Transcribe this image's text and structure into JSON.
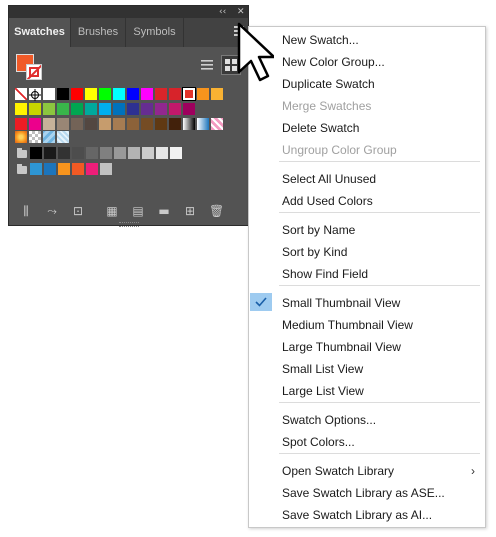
{
  "panel": {
    "titlebar": {
      "collapse_glyph": "‹‹",
      "close_glyph": "✕"
    },
    "tabs": [
      {
        "label": "Swatches",
        "active": true
      },
      {
        "label": "Brushes",
        "active": false
      },
      {
        "label": "Symbols",
        "active": false
      }
    ],
    "fill_color": "#f05a28",
    "view_mode": "small-thumbnail",
    "swatch_rows": [
      [
        "none",
        "registration",
        "#ffffff",
        "#000000",
        "#ff0000",
        "#ffff00",
        "#00ff00",
        "#00ffff",
        "#0000ff",
        "#ff00ff",
        "#d9252a",
        "#d7232a",
        "#e3342c",
        "#f7941d",
        "#f9b233"
      ],
      [
        "#fff200",
        "#c8d400",
        "#8cc63f",
        "#39b54a",
        "#00a651",
        "#00a99d",
        "#00aeef",
        "#0072bc",
        "#2e3192",
        "#662d91",
        "#92278f",
        "#c2186b",
        "#9e005d"
      ],
      [
        "#ed1c24",
        "#ec008c",
        "#c7b299",
        "#998675",
        "#736357",
        "#534741",
        "#c69c6d",
        "#a67c52",
        "#8c6239",
        "#754c24",
        "#603913",
        "#42210b",
        "gradient-bw",
        "gradient-blue",
        "pattern-pink"
      ],
      [
        "pattern-sun",
        "pattern-check",
        "pattern-blue",
        "pattern-diamond"
      ],
      [
        "#000000",
        "#1a1a1a",
        "#333333",
        "#4d4d4d",
        "#666666",
        "#808080",
        "#999999",
        "#b3b3b3",
        "#cccccc",
        "#e6e6e6",
        "#f2f2f2"
      ],
      [
        "#2e96d4",
        "#1c75bc",
        "#f7941d",
        "#f15a24",
        "#ed1e79",
        "#c1c1c1"
      ]
    ],
    "bottom_icons": [
      "library-icon",
      "place-swatch-icon",
      "swatch-kind-icon",
      "swatch-options-icon",
      "new-color-group-icon",
      "new-swatch-folder-icon",
      "new-swatch-icon",
      "delete-swatch-icon"
    ]
  },
  "menu": {
    "items": [
      {
        "label": "New Swatch...",
        "enabled": true
      },
      {
        "label": "New Color Group...",
        "enabled": true
      },
      {
        "label": "Duplicate Swatch",
        "enabled": true
      },
      {
        "label": "Merge Swatches",
        "enabled": false
      },
      {
        "label": "Delete Swatch",
        "enabled": true
      },
      {
        "label": "Ungroup Color Group",
        "enabled": false
      },
      {
        "label": "Select All Unused",
        "enabled": true
      },
      {
        "label": "Add Used Colors",
        "enabled": true
      },
      {
        "label": "Sort by Name",
        "enabled": true
      },
      {
        "label": "Sort by Kind",
        "enabled": true
      },
      {
        "label": "Show Find Field",
        "enabled": true
      },
      {
        "label": "Small Thumbnail View",
        "enabled": true,
        "checked": true
      },
      {
        "label": "Medium Thumbnail View",
        "enabled": true
      },
      {
        "label": "Large Thumbnail View",
        "enabled": true
      },
      {
        "label": "Small List View",
        "enabled": true
      },
      {
        "label": "Large List View",
        "enabled": true
      },
      {
        "label": "Swatch Options...",
        "enabled": true
      },
      {
        "label": "Spot Colors...",
        "enabled": true
      },
      {
        "label": "Open Swatch Library",
        "enabled": true,
        "submenu": true
      },
      {
        "label": "Save Swatch Library as ASE...",
        "enabled": true
      },
      {
        "label": "Save Swatch Library as AI...",
        "enabled": true
      }
    ],
    "check_color": "#9ecbf0"
  }
}
